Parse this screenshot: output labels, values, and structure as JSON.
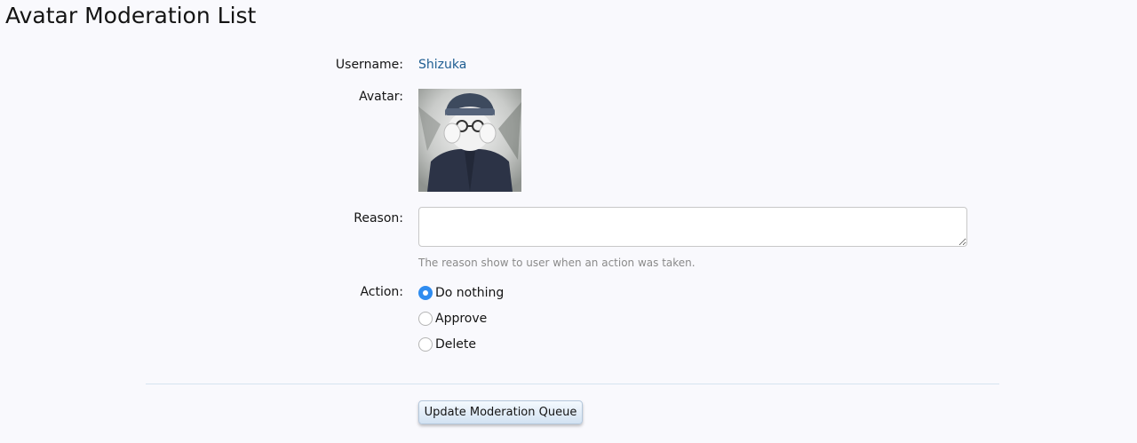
{
  "page": {
    "title": "Avatar Moderation List"
  },
  "form": {
    "username_label": "Username:",
    "username_value": "Shizuka",
    "avatar_label": "Avatar:",
    "reason_label": "Reason:",
    "reason_value": "",
    "reason_hint": "The reason show to user when an action was taken.",
    "action_label": "Action:",
    "actions": [
      {
        "label": "Do nothing",
        "selected": true
      },
      {
        "label": "Approve",
        "selected": false
      },
      {
        "label": "Delete",
        "selected": false
      }
    ],
    "submit_label": "Update Moderation Queue"
  },
  "colors": {
    "link": "#1e5d91",
    "radio_checked": "#2f8cf0",
    "background": "#f9f9fd"
  }
}
